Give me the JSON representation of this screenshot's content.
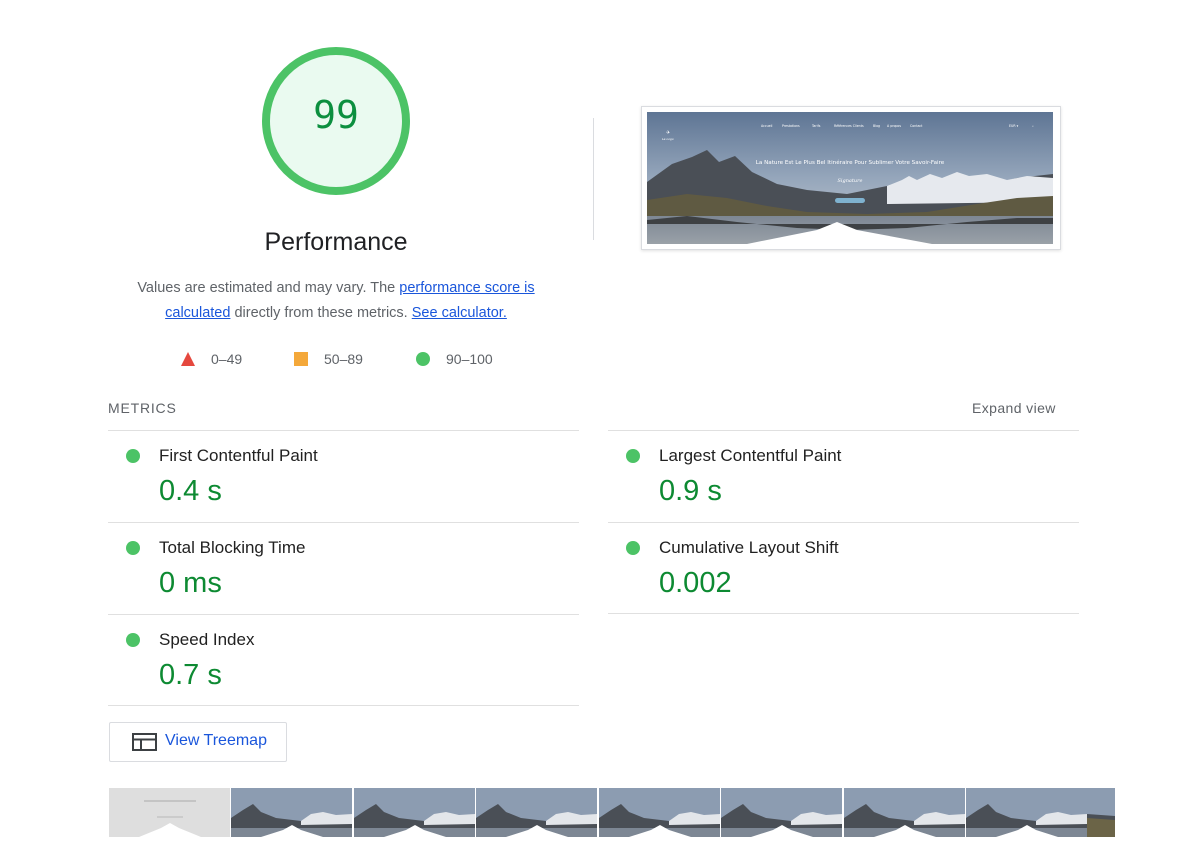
{
  "gauge": {
    "score": "99",
    "title": "Performance",
    "color": "#4cc366",
    "fill": "#eafaf0",
    "text_color": "#0c8f3f"
  },
  "description": {
    "prefix": "Values are estimated and may vary. The ",
    "link1": "performance score is calculated",
    "middle": " directly from these metrics. ",
    "link2": "See calculator."
  },
  "legend": [
    {
      "shape": "triangle",
      "range": "0–49",
      "color": "#e5483e"
    },
    {
      "shape": "square",
      "range": "50–89",
      "color": "#f4a83a"
    },
    {
      "shape": "circle",
      "range": "90–100",
      "color": "#4cc366"
    }
  ],
  "preview": {
    "nav_items": [
      "Accueil",
      "Prestations",
      "Tarifs",
      "Références Clients",
      "Blog",
      "A propos",
      "Contact"
    ],
    "headline": "La Nature Est Le Plus Bel Itinéraire Pour Sublimer Votre Savoir-Faire"
  },
  "metrics_section": {
    "label": "METRICS",
    "expand": "Expand view"
  },
  "metrics": [
    {
      "name": "First Contentful Paint",
      "value": "0.4 s",
      "status": "good"
    },
    {
      "name": "Largest Contentful Paint",
      "value": "0.9 s",
      "status": "good"
    },
    {
      "name": "Total Blocking Time",
      "value": "0 ms",
      "status": "good"
    },
    {
      "name": "Cumulative Layout Shift",
      "value": "0.002",
      "status": "good"
    },
    {
      "name": "Speed Index",
      "value": "0.7 s",
      "status": "good"
    }
  ],
  "treemap": {
    "label": "View Treemap",
    "icon": "treemap-icon"
  },
  "filmstrip": {
    "frame_count": 8
  }
}
